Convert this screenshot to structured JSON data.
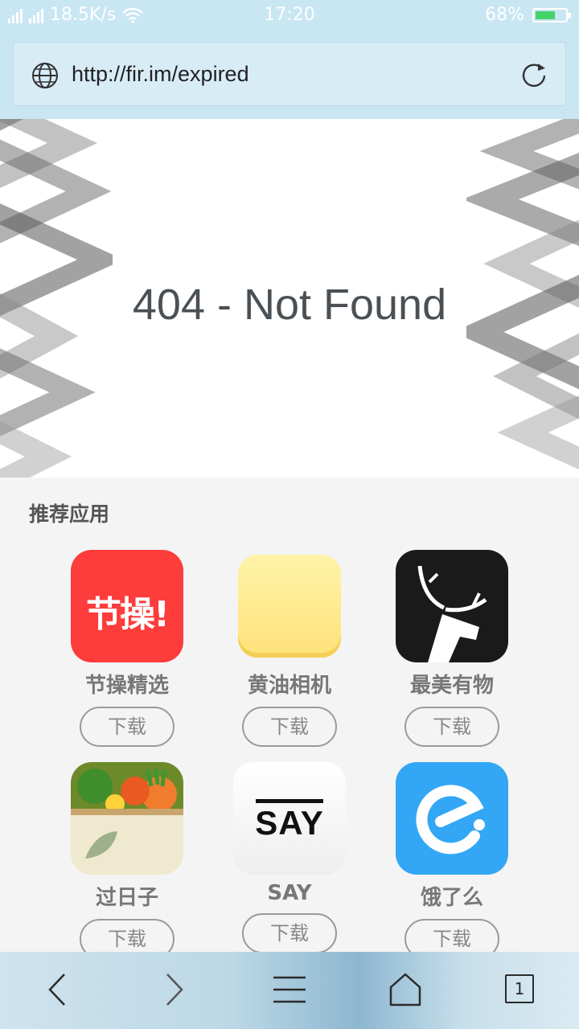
{
  "status": {
    "speed": "18.5K/s",
    "time": "17:20",
    "battery": "68%",
    "battery_level": 0.68,
    "net_tags": [
      "2G",
      "4G"
    ]
  },
  "address": {
    "url": "http://fir.im/expired",
    "globe_icon": "globe-icon",
    "reload_icon": "reload-icon"
  },
  "page": {
    "message": "404 - Not Found"
  },
  "recommend": {
    "title": "推荐应用",
    "download_label": "下载",
    "apps": [
      {
        "name": "节操精选",
        "icon_text": "节操!",
        "color": "#fd3c3c"
      },
      {
        "name": "黄油相机",
        "icon_text": "",
        "color": "#ffe38a"
      },
      {
        "name": "最美有物",
        "icon_text": "",
        "color": "#1a1a1a"
      },
      {
        "name": "过日子",
        "icon_text": "",
        "color": "#efe9cf"
      },
      {
        "name": "SAY",
        "icon_text": "SAY",
        "color": "#f7f7f7"
      },
      {
        "name": "饿了么",
        "icon_text": "e",
        "color": "#33a7f5"
      }
    ]
  },
  "navbar": {
    "back_icon": "back-icon",
    "forward_icon": "forward-icon",
    "menu_icon": "menu-icon",
    "home_icon": "home-icon",
    "tabs_count": "1"
  }
}
